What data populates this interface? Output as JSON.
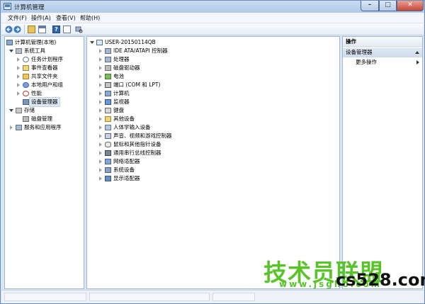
{
  "window": {
    "title": "计算机管理"
  },
  "menubar": [
    "文件(F)",
    "操作(A)",
    "查看(V)",
    "帮助(H)"
  ],
  "left_tree": [
    {
      "label": "计算机管理(本地)",
      "icon": "computer-icon",
      "level": 0,
      "expander": "none"
    },
    {
      "label": "系统工具",
      "icon": "tools-icon",
      "level": 1,
      "expander": "open"
    },
    {
      "label": "任务计划程序",
      "icon": "clock-icon",
      "level": 2,
      "expander": "closed"
    },
    {
      "label": "事件查看器",
      "icon": "event-icon",
      "level": 2,
      "expander": "closed"
    },
    {
      "label": "共享文件夹",
      "icon": "share-icon",
      "level": 2,
      "expander": "closed"
    },
    {
      "label": "本地用户和组",
      "icon": "users-icon",
      "level": 2,
      "expander": "closed"
    },
    {
      "label": "性能",
      "icon": "perf-icon",
      "level": 2,
      "expander": "closed"
    },
    {
      "label": "设备管理器",
      "icon": "devmgr-icon",
      "level": 2,
      "expander": "none",
      "selected": true
    },
    {
      "label": "存储",
      "icon": "storage-icon",
      "level": 1,
      "expander": "open"
    },
    {
      "label": "磁盘管理",
      "icon": "disk-icon",
      "level": 2,
      "expander": "none"
    },
    {
      "label": "服务和应用程序",
      "icon": "services-icon",
      "level": 1,
      "expander": "closed"
    }
  ],
  "device_tree": {
    "root": "USER-20150114QB",
    "items": [
      {
        "label": "IDE ATA/ATAPI 控制器",
        "icon": "ide-controller-icon"
      },
      {
        "label": "处理器",
        "icon": "processor-icon"
      },
      {
        "label": "磁盘驱动器",
        "icon": "disk-drive-icon"
      },
      {
        "label": "电池",
        "icon": "battery-icon"
      },
      {
        "label": "端口 (COM 和 LPT)",
        "icon": "port-icon"
      },
      {
        "label": "计算机",
        "icon": "computer-icon"
      },
      {
        "label": "监视器",
        "icon": "monitor-icon"
      },
      {
        "label": "键盘",
        "icon": "keyboard-icon"
      },
      {
        "label": "其他设备",
        "icon": "other-devices-icon"
      },
      {
        "label": "人体学输入设备",
        "icon": "hid-icon"
      },
      {
        "label": "声音、视频和游戏控制器",
        "icon": "sound-icon"
      },
      {
        "label": "鼠标和其他指针设备",
        "icon": "mouse-icon"
      },
      {
        "label": "通用串行总线控制器",
        "icon": "usb-icon"
      },
      {
        "label": "网络适配器",
        "icon": "network-icon"
      },
      {
        "label": "系统设备",
        "icon": "system-devices-icon"
      },
      {
        "label": "显示适配器",
        "icon": "display-adapter-icon"
      }
    ]
  },
  "actions": {
    "header": "操作",
    "group": "设备管理器",
    "more": "更多操作"
  },
  "watermark": {
    "main": "技术员联盟",
    "site": "www.jsgho.com",
    "url": "cs528.com"
  }
}
